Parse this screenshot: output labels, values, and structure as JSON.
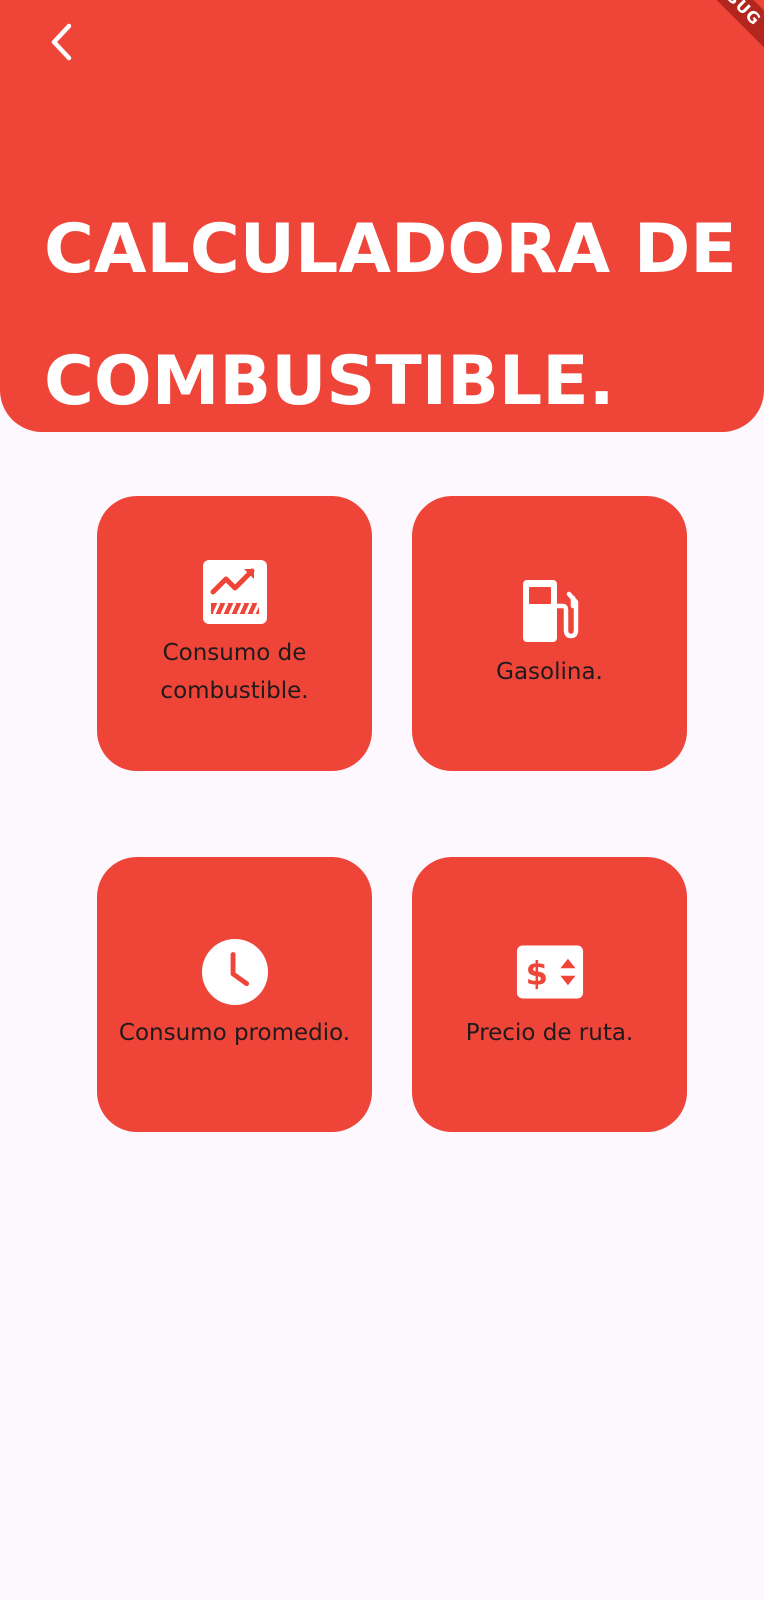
{
  "header": {
    "title_line1": "CALCULADORA DE",
    "title_line2": "COMBUSTIBLE.",
    "back_icon": "chevron-left-icon",
    "debug_banner": "DEBUG"
  },
  "menu": {
    "items": [
      {
        "label_line1": "Consumo de",
        "label_line2": "combustible.",
        "icon": "chart-icon"
      },
      {
        "label_line1": "Gasolina.",
        "label_line2": "",
        "icon": "gas-pump-icon"
      },
      {
        "label_line1": "Consumo promedio.",
        "label_line2": "",
        "icon": "clock-icon"
      },
      {
        "label_line1": "Precio de ruta.",
        "label_line2": "",
        "icon": "price-change-icon"
      }
    ]
  },
  "colors": {
    "accent": "#EF4438",
    "background": "#FDF7FE",
    "text_dark": "#1F1A1C",
    "text_light": "#FFFFFF"
  }
}
